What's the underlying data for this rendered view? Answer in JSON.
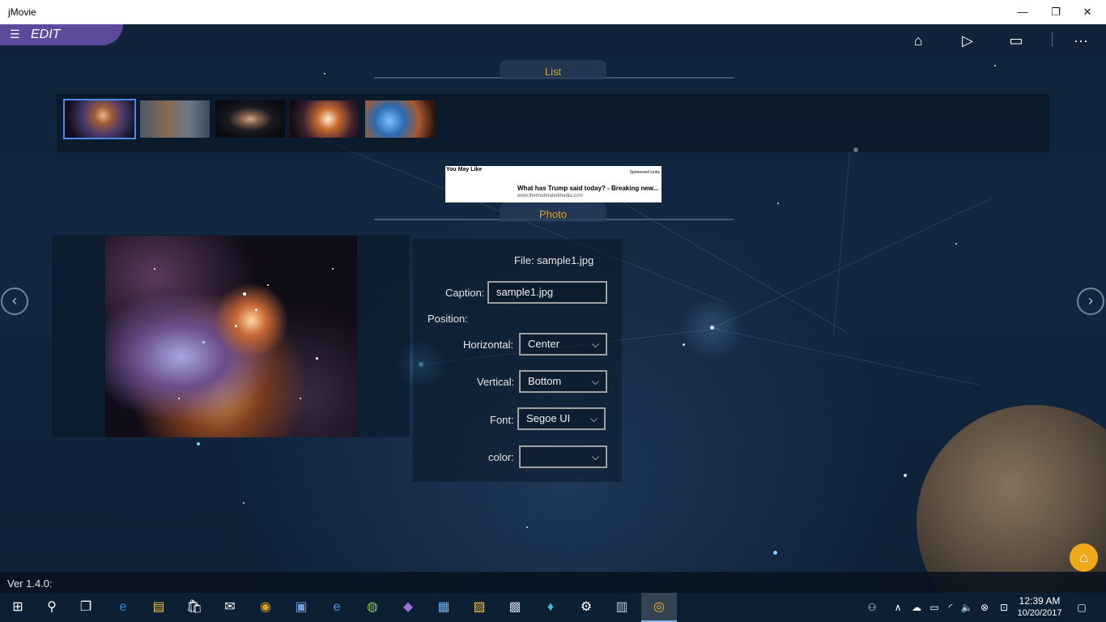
{
  "window": {
    "title": "jMovie",
    "minimize_glyph": "—",
    "maximize_glyph": "❐",
    "close_glyph": "✕"
  },
  "header": {
    "menu_glyph": "☰",
    "mode_label": "EDIT",
    "icons": {
      "home": "⌂",
      "play": "▷",
      "camera": "▭",
      "more": "···"
    }
  },
  "list_section": {
    "tab_label": "List",
    "thumbnails": [
      "sample1.jpg",
      "thumb-2",
      "thumb-3",
      "thumb-4",
      "thumb-5"
    ],
    "selected_index": 0
  },
  "ad": {
    "you_may_like": "You May Like",
    "sponsored": "Sponsored Links",
    "headline": "What has Trump said today? - Breaking new...",
    "url": "www.themoderatedmedia.com"
  },
  "photo_section": {
    "tab_label": "Photo",
    "file_label": "File: sample1.jpg",
    "caption_label": "Caption:",
    "caption_value": "sample1.jpg",
    "position_label": "Position:",
    "horizontal_label": "Horizontal:",
    "horizontal_value": "Center",
    "vertical_label": "Vertical:",
    "vertical_value": "Bottom",
    "font_label": "Font:",
    "font_value": "Segoe UI",
    "color_label": "color:",
    "color_value": "",
    "chevron": "⌵"
  },
  "nav": {
    "prev_glyph": "‹",
    "next_glyph": "›",
    "home_glyph": "⌂"
  },
  "status": {
    "version": "Ver 1.4.0:"
  },
  "taskbar": {
    "start_glyph": "⊞",
    "search_glyph": "⚲",
    "taskview_glyph": "❐",
    "apps": [
      "e",
      "▤",
      "🛍",
      "✉",
      "◉",
      "▣",
      "e",
      "◍",
      "◆",
      "▦",
      "▨",
      "▩",
      "♦",
      "⚙",
      "▥",
      "◎"
    ],
    "tray_icons": [
      "⚇",
      "∧",
      "☁",
      "▭",
      "◜",
      "🔈",
      "⊗",
      "⊡"
    ],
    "time": "12:39 AM",
    "date": "10/20/2017",
    "notification_glyph": "▢"
  },
  "colors": {
    "edit_tab": "#5d4a9c",
    "section_label": "#e0a030",
    "home_fab": "#f0a818",
    "taskbar": "#0d1f33"
  }
}
